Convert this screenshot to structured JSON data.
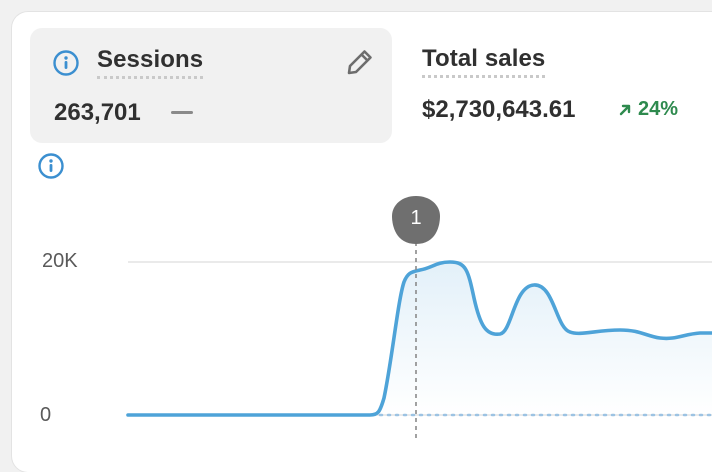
{
  "metrics": [
    {
      "title": "Sessions",
      "value": "263,701",
      "selected": true
    },
    {
      "title": "Total sales",
      "value": "$2,730,643.61",
      "trend": {
        "direction": "up",
        "value": "24%",
        "color": "#2e8a4e"
      }
    }
  ],
  "marker": {
    "label": "1"
  },
  "chart_data": {
    "type": "area",
    "y_ticks": [
      "20K",
      "0"
    ],
    "ylim": [
      0,
      20000
    ],
    "grid": true,
    "series": [
      {
        "color": "#4ea3d8",
        "values": [
          0,
          0,
          0,
          0,
          0,
          0,
          0,
          0,
          0,
          0,
          0,
          0,
          0,
          0,
          0,
          0,
          0,
          0,
          0,
          0,
          0,
          0,
          0,
          0,
          0,
          0,
          0,
          300,
          18500,
          19800,
          19600,
          12000,
          16800,
          11800,
          11200,
          10800,
          10000,
          10800,
          10600
        ]
      }
    ],
    "comparison_series": {
      "style": "dotted",
      "values": "flat at 0"
    }
  }
}
